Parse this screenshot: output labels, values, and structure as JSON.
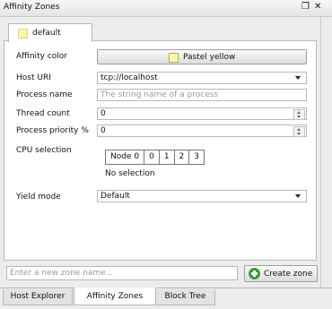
{
  "window": {
    "title": "Affinity Zones"
  },
  "zone_tab": {
    "label": "default",
    "color": "#fbf6a6"
  },
  "form": {
    "affinity_color_label": "Affinity color",
    "affinity_color_value": "Pastel yellow",
    "host_uri_label": "Host URI",
    "host_uri_value": "tcp://localhost",
    "process_name_label": "Process name",
    "process_name_placeholder": "The string name of a process",
    "thread_count_label": "Thread count",
    "thread_count_value": "0",
    "process_priority_label": "Process priority %",
    "process_priority_value": "0",
    "cpu_selection_label": "CPU selection",
    "cpu_cells": [
      "Node 0",
      "0",
      "1",
      "2",
      "3"
    ],
    "cpu_status": "No selection",
    "yield_mode_label": "Yield mode",
    "yield_mode_value": "Default"
  },
  "new_zone": {
    "placeholder": "Enter a new zone name...",
    "create_label": "Create zone"
  },
  "bottom_tabs": [
    "Host Explorer",
    "Affinity Zones",
    "Block Tree"
  ]
}
